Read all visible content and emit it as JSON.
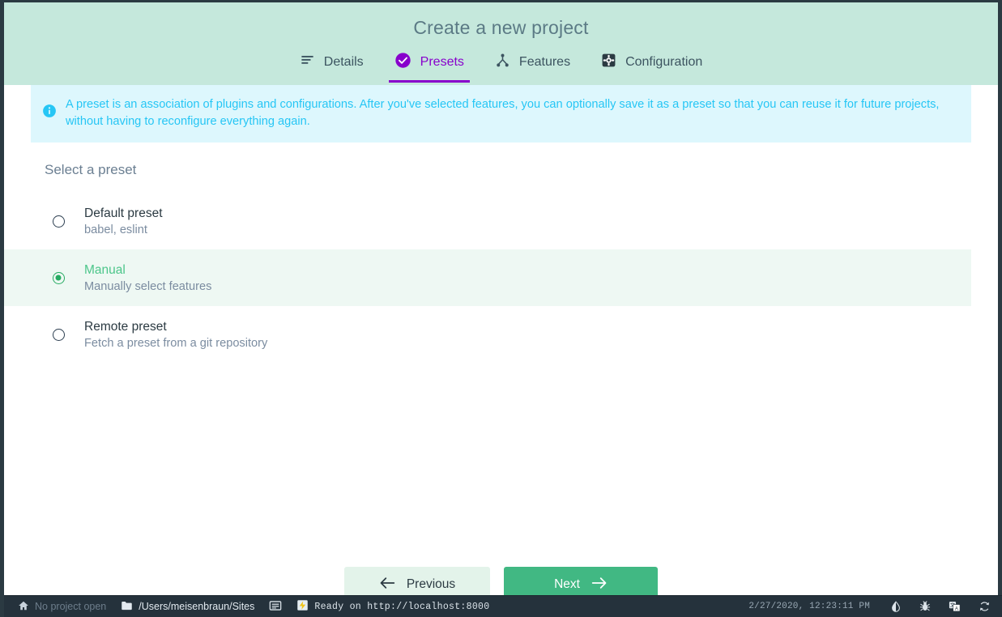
{
  "window": {
    "title": "Create a new project"
  },
  "header": {
    "title": "Create a new project",
    "tabs": [
      {
        "label": "Details",
        "icon": "list-lines-icon",
        "active": false
      },
      {
        "label": "Presets",
        "icon": "check-circle-icon",
        "active": true
      },
      {
        "label": "Features",
        "icon": "sitemap-icon",
        "active": false
      },
      {
        "label": "Configuration",
        "icon": "gear-square-icon",
        "active": false
      }
    ],
    "active_color": "#8800cc",
    "background": "#c5e8dc"
  },
  "banner": {
    "icon": "info-circle-icon",
    "text": "A preset is an association of plugins and configurations. After you've selected features, you can optionally save it as a preset so that you can reuse it for future projects, without having to reconfigure everything again.",
    "background": "#ddf7fd",
    "text_color": "#26c6f5"
  },
  "main": {
    "section_title": "Select a preset",
    "presets": [
      {
        "name": "Default preset",
        "description": "babel, eslint",
        "selected": false
      },
      {
        "name": "Manual",
        "description": "Manually select features",
        "selected": true
      },
      {
        "name": "Remote preset",
        "description": "Fetch a preset from a git repository",
        "selected": false
      }
    ],
    "selected_color": "#4cc68a",
    "selected_row_background": "#eef8f3"
  },
  "footer": {
    "previous_label": "Previous",
    "next_label": "Next",
    "previous_icon": "arrow-left-icon",
    "next_icon": "arrow-right-icon",
    "next_color": "#41b883",
    "previous_color": "#e3f3ea"
  },
  "statusbar": {
    "project_status": "No project open",
    "project_icon": "home-icon",
    "path": "/Users/meisenbraun/Sites",
    "path_icon": "folder-icon",
    "terminal_icon": "terminal-icon",
    "server_icon": "server-badge-icon",
    "server_status": "Ready on http://localhost:8000",
    "datetime": "2/27/2020, 12:23:11 PM",
    "icons": [
      {
        "name": "theme-contrast-icon"
      },
      {
        "name": "bug-icon"
      },
      {
        "name": "translate-icon"
      },
      {
        "name": "refresh-icon"
      }
    ]
  }
}
